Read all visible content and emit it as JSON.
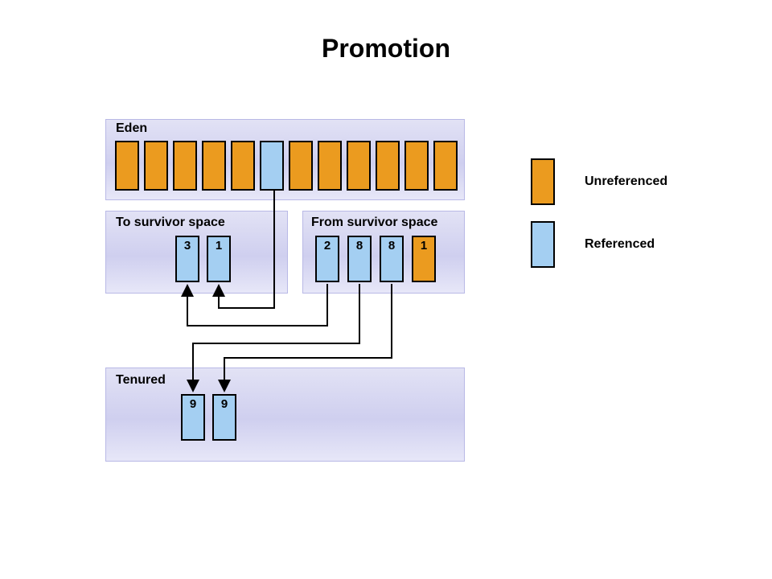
{
  "title": "Promotion",
  "regions": {
    "eden": {
      "label": "Eden"
    },
    "to_survivor": {
      "label": "To survivor space"
    },
    "from_survivor": {
      "label": "From survivor space"
    },
    "tenured": {
      "label": "Tenured"
    }
  },
  "eden_slots": [
    {
      "type": "unreferenced"
    },
    {
      "type": "unreferenced"
    },
    {
      "type": "unreferenced"
    },
    {
      "type": "unreferenced"
    },
    {
      "type": "unreferenced"
    },
    {
      "type": "referenced"
    },
    {
      "type": "unreferenced"
    },
    {
      "type": "unreferenced"
    },
    {
      "type": "unreferenced"
    },
    {
      "type": "unreferenced"
    },
    {
      "type": "unreferenced"
    },
    {
      "type": "unreferenced"
    }
  ],
  "to_survivor_slots": [
    {
      "type": "referenced",
      "value": "3"
    },
    {
      "type": "referenced",
      "value": "1"
    }
  ],
  "from_survivor_slots": [
    {
      "type": "referenced",
      "value": "2"
    },
    {
      "type": "referenced",
      "value": "8"
    },
    {
      "type": "referenced",
      "value": "8"
    },
    {
      "type": "unreferenced",
      "value": "1"
    }
  ],
  "tenured_slots": [
    {
      "type": "referenced",
      "value": "9"
    },
    {
      "type": "referenced",
      "value": "9"
    }
  ],
  "legend": {
    "unreferenced": "Unreferenced",
    "referenced": "Referenced"
  },
  "colors": {
    "unreferenced": "#eb9b1f",
    "referenced": "#a4cff2",
    "region_fill_top": "#e2e2f5",
    "region_fill_mid": "#cfcfef",
    "region_fill_bottom": "#e7e7f8"
  }
}
